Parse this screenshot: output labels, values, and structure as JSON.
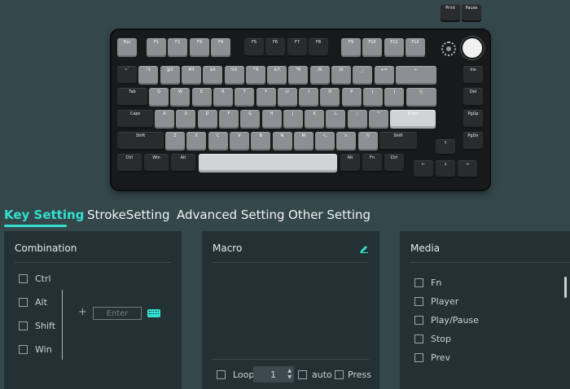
{
  "colors": {
    "accent": "#33e0cf",
    "background": "#34474b",
    "panel": "#233134"
  },
  "keyboard": {
    "extra_keys": [
      "Print",
      "Pause"
    ],
    "row_f": [
      "Esc",
      "F1",
      "F2",
      "F3",
      "F4",
      "F5",
      "F6",
      "F7",
      "F8",
      "F9",
      "F10",
      "F11",
      "F12"
    ],
    "row_1": [
      "~`",
      "!1",
      "@2",
      "#3",
      "$4",
      "%5",
      "^6",
      "&7",
      "*8",
      "(9",
      ")0",
      "_-",
      "+=",
      "←"
    ],
    "row_2": [
      "Tab",
      "Q",
      "W",
      "E",
      "R",
      "T",
      "Y",
      "U",
      "I",
      "O",
      "P",
      "[",
      "]",
      "\\|"
    ],
    "row_3": [
      "Caps",
      "A",
      "S",
      "D",
      "F",
      "G",
      "H",
      "J",
      "K",
      "L",
      ":;",
      "\"'",
      "Enter"
    ],
    "row_4": [
      "Shift",
      "Z",
      "X",
      "C",
      "V",
      "B",
      "N",
      "M",
      "<,",
      ">.",
      "?/",
      "Shift"
    ],
    "row_5": [
      "Ctrl",
      "Win",
      "Alt",
      "",
      "Alt",
      "Fn",
      "Ctrl"
    ],
    "nav": [
      "Ins",
      "Del",
      "PgUp",
      "PgDn"
    ],
    "arrows": [
      "↑",
      "←",
      "↓",
      "→"
    ]
  },
  "tabs": [
    {
      "label": "Key Setting"
    },
    {
      "label": "StrokeSetting"
    },
    {
      "label": "Advanced Setting"
    },
    {
      "label": "Other Setting"
    }
  ],
  "combination": {
    "title": "Combination",
    "modifiers": [
      "Ctrl",
      "Alt",
      "Shift",
      "Win"
    ],
    "plus": "+",
    "enter_placeholder": "Enter"
  },
  "macro": {
    "title": "Macro",
    "loop_label": "Loop",
    "loop_value": "1",
    "auto_label": "auto",
    "press_label": "Press"
  },
  "media": {
    "title": "Media",
    "items": [
      "Fn",
      "Player",
      "Play/Pause",
      "Stop",
      "Prev"
    ]
  }
}
